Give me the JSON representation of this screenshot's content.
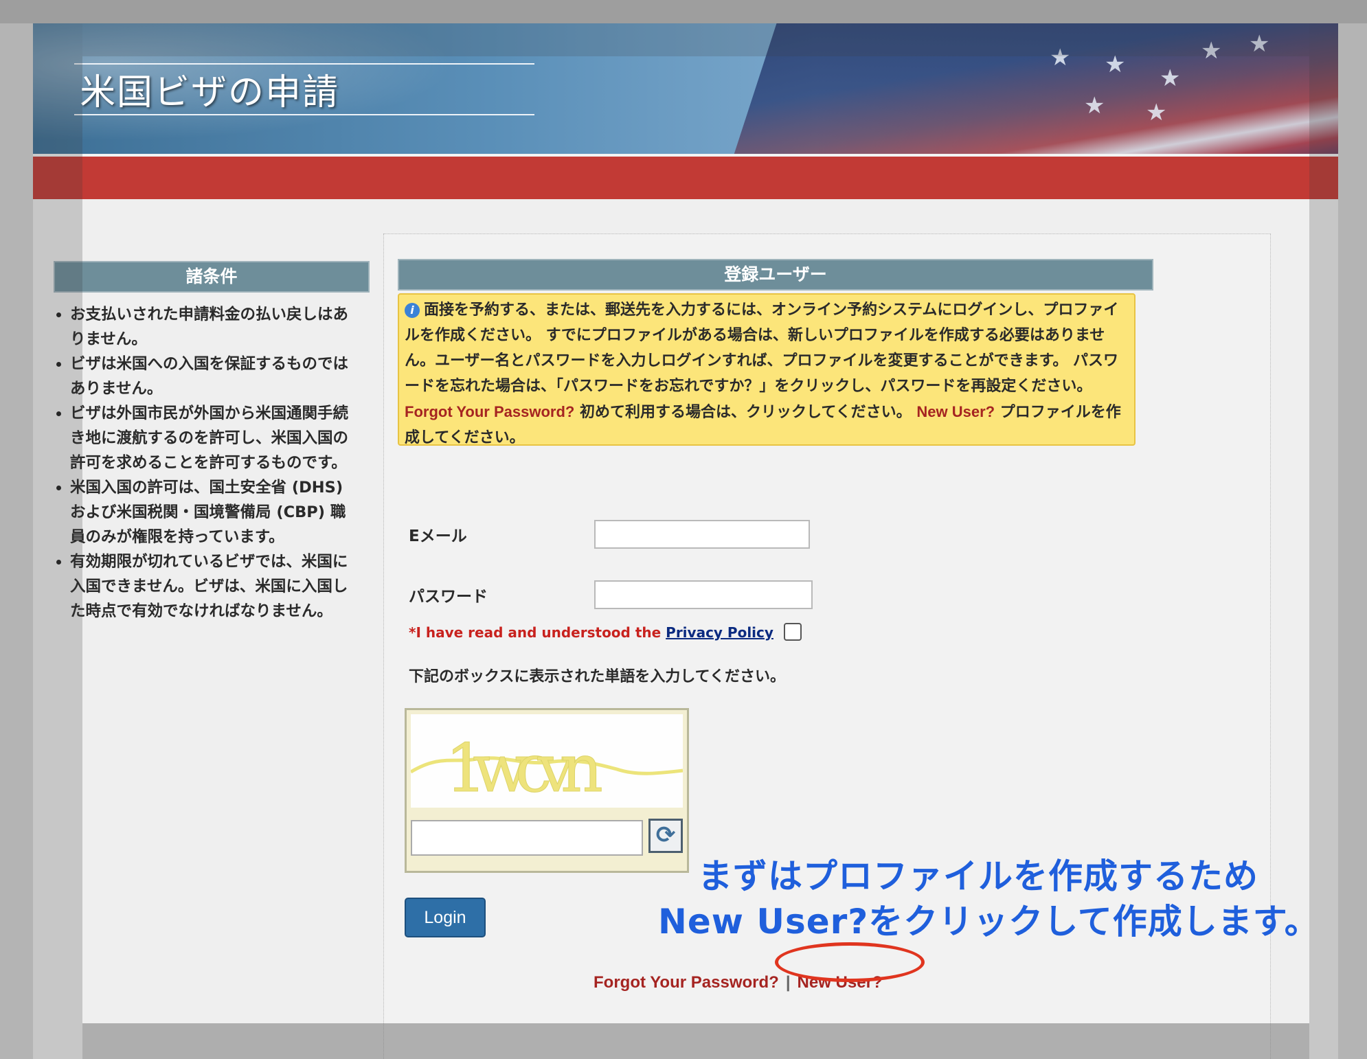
{
  "header": {
    "title": "米国ビザの申請"
  },
  "sidebar": {
    "heading": "諸条件",
    "items": [
      "お支払いされた申請料金の払い戻しはありません。",
      "ビザは米国への入国を保証するものではありません。",
      "ビザは外国市民が外国から米国通関手続き地に渡航するのを許可し、米国入国の許可を求めることを許可するものです。",
      "米国入国の許可は、国土安全省 (DHS) および米国税関・国境警備局 (CBP) 職員のみが権限を持っています。",
      "有効期限が切れているビザでは、米国に入国できません。ビザは、米国に入国した時点で有効でなければなりません。"
    ]
  },
  "main": {
    "heading": "登録ユーザー",
    "notice": {
      "icon": "info-icon",
      "text_1": "面接を予約する、または、郵送先を入力するには、オンライン予約システムにログインし、プロファイルを作成ください。 すでにプロファイルがある場合は、新しいプロファイルを作成する必要はありません。ユーザー名とパスワードを入力しログインすれば、プロファイルを変更することができます。 パスワードを忘れた場合は、「パスワードをお忘れですか？」をクリックし、パスワードを再設定ください。",
      "forgot_link": "Forgot Your Password?",
      "text_2": "初めて利用する場合は、クリックしてください。",
      "new_user_link": "New User?",
      "text_3": "プロファイルを作成してください。"
    },
    "form": {
      "email_label": "Eメール",
      "email_value": "",
      "password_label": "パスワード",
      "password_value": "",
      "privacy_prefix": "*I have read and understood the",
      "privacy_link": "Privacy Policy",
      "privacy_checked": false,
      "captcha_instruction": "下記のボックスに表示された単語を入力してください。",
      "captcha_text": "1wcvn",
      "captcha_value": "",
      "refresh_icon": "refresh-icon",
      "login_label": "Login"
    },
    "links": {
      "forgot": "Forgot Your Password?",
      "separator": "|",
      "new_user": "New User?"
    }
  },
  "annotation": {
    "line_1": "まずはプロファイルを作成するため",
    "line_2": "New User?をクリックして作成します。"
  },
  "colors": {
    "accent_red": "#c23a35",
    "header_slate": "#6e8e9a",
    "notice_yellow": "#fce57a",
    "link_red": "#a52421",
    "annotation_blue": "#1f5fdc",
    "highlight_ellipse": "#e0351f",
    "login_blue": "#2e6fa7"
  }
}
